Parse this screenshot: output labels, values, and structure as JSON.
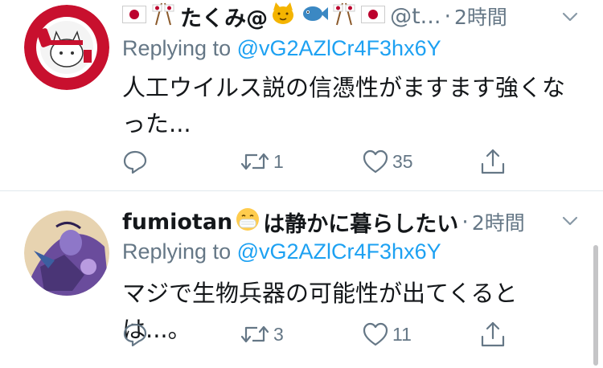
{
  "tweets": [
    {
      "name_emoji_prefix": [
        "jp-flag-icon",
        "crossed-flags-icon"
      ],
      "name": "たくみ@",
      "name_emoji_suffix": [
        "cat-face-icon",
        "fish-icon",
        "crossed-flags-icon",
        "jp-flag-icon"
      ],
      "handle": "@t...",
      "dot": "·",
      "time": "2時間",
      "replying_prefix": "Replying to",
      "replying_to": "@vG2AZlCr4F3hx6Y",
      "text": "人工ウイルス説の信憑性がますます強くなった...",
      "reply_count": "",
      "retweet_count": "1",
      "like_count": "35"
    },
    {
      "name": "fumiotan",
      "name_emoji": "mask-face-icon",
      "name_suffix": "は静かに暮らしたい",
      "dot": "·",
      "time": "2時間",
      "replying_prefix": "Replying to",
      "replying_to": "@vG2AZlCr4F3hx6Y",
      "text": "マジで生物兵器の可能性が出てくるとは...。",
      "reply_count": "",
      "retweet_count": "3",
      "like_count": "11"
    }
  ],
  "colors": {
    "text": "#14171a",
    "secondary": "#657786",
    "link": "#1da1f2",
    "divider": "#e1e8ed"
  }
}
